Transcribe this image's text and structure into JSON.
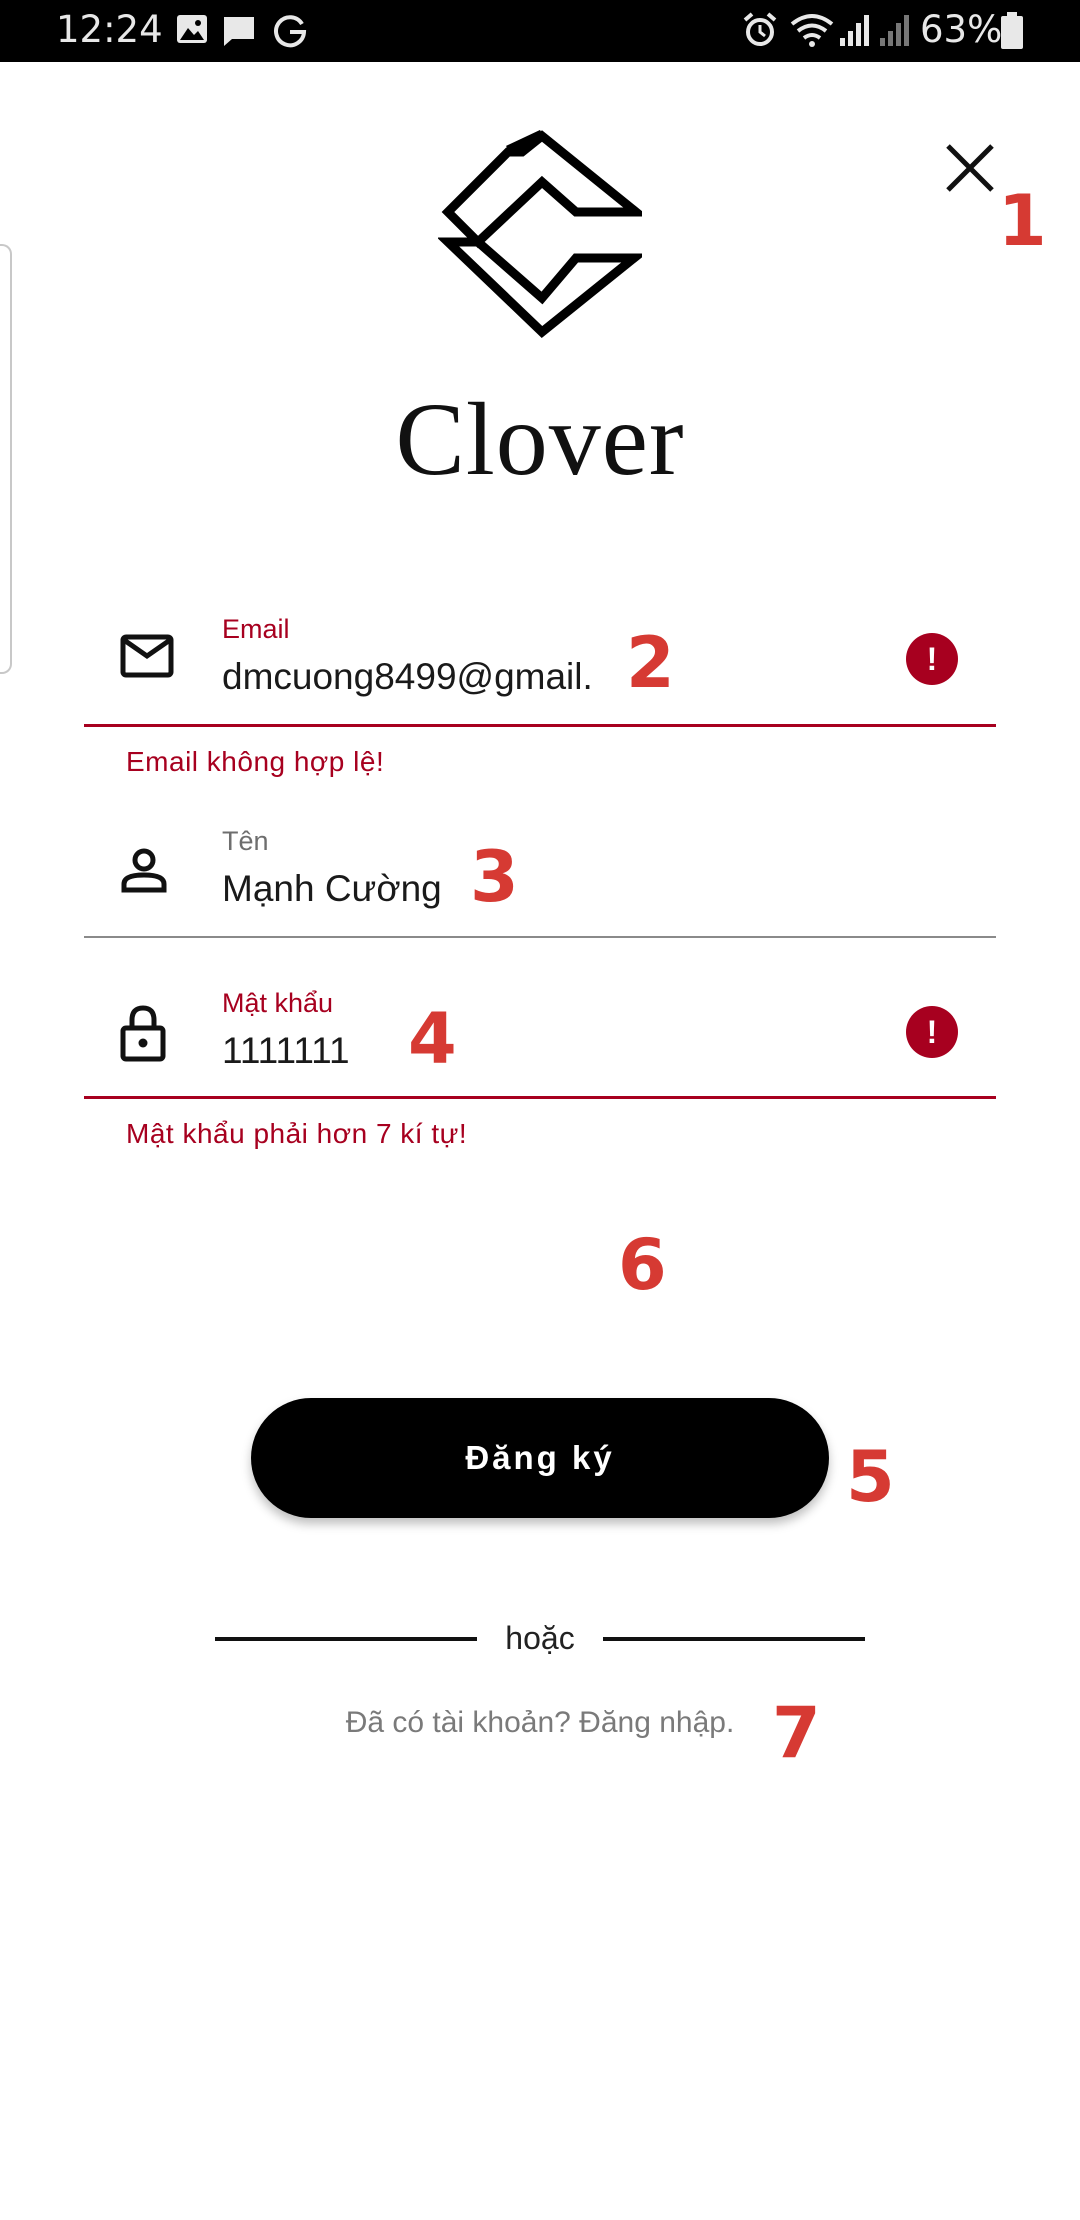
{
  "status_bar": {
    "time": "12:24",
    "battery": "63%",
    "icons": [
      "image-icon",
      "message-icon",
      "g-icon",
      "alarm-icon",
      "wifi-icon",
      "signal-icon",
      "signal-icon",
      "battery-icon"
    ]
  },
  "brand": {
    "name": "Clover"
  },
  "fields": {
    "email": {
      "label": "Email",
      "value": "dmcuong8499@gmail.",
      "error": "Email không hợp lệ!"
    },
    "name": {
      "label": "Tên",
      "value": "Mạnh Cường"
    },
    "password": {
      "label": "Mật khẩu",
      "value": "1111111",
      "error": "Mật khẩu phải hơn 7 kí tự!"
    }
  },
  "actions": {
    "signup_label": "Đăng ký",
    "divider_label": "hoặc",
    "login_prompt": "Đã có tài khoản? Đăng nhập."
  },
  "annotations": [
    "1",
    "2",
    "3",
    "4",
    "5",
    "6",
    "7"
  ],
  "error_icon_glyph": "!",
  "colors": {
    "error": "#a7001f",
    "annotation": "#d63a33",
    "button": "#000000",
    "underline_default": "#8a8a8a"
  }
}
